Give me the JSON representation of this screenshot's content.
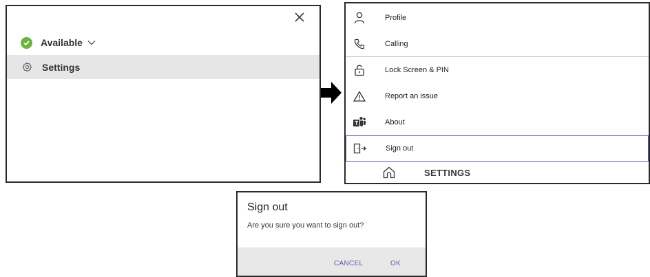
{
  "status_menu": {
    "status_label": "Available",
    "status_color": "#6cb33f",
    "settings_label": "Settings",
    "icons": [
      "close-icon",
      "check-circle-icon",
      "chevron-down-icon",
      "gear-icon"
    ]
  },
  "settings_menu": {
    "items": [
      {
        "label": "Profile",
        "icon": "person-icon"
      },
      {
        "label": "Calling",
        "icon": "phone-icon"
      },
      {
        "label": "Lock Screen & PIN",
        "icon": "lock-icon"
      },
      {
        "label": "Report an issue",
        "icon": "warning-icon"
      },
      {
        "label": "About",
        "icon": "teams-logo-icon"
      },
      {
        "label": "Sign out",
        "icon": "sign-out-icon"
      }
    ],
    "footer_title": "SETTINGS",
    "footer_icon": "home-icon",
    "highlight_color": "#5b5bb0"
  },
  "dialog": {
    "title": "Sign out",
    "message": "Are you sure you want to sign out?",
    "cancel_label": "CANCEL",
    "ok_label": "OK",
    "button_color": "#5b5bb0"
  }
}
